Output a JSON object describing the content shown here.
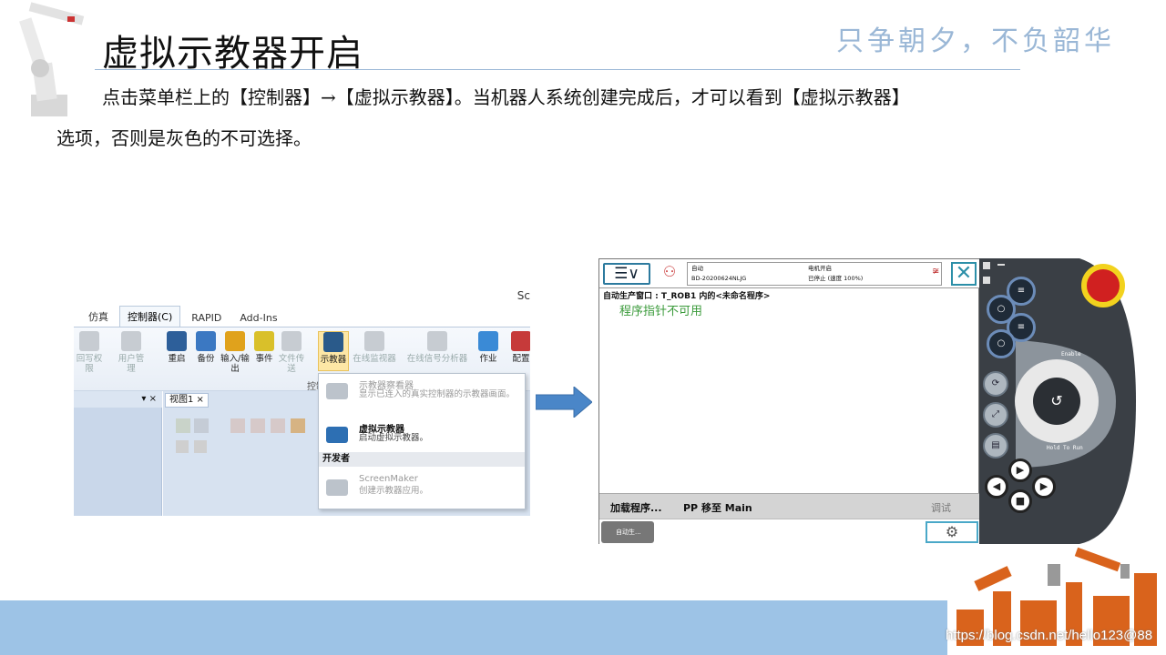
{
  "slide": {
    "title": "虚拟示教器开启",
    "motto": "只争朝夕，不负韶华",
    "body_line1": "点击菜单栏上的【控制器】→【虚拟示教器】。当机器人系统创建完成后，才可以看到【虚拟示教器】",
    "body_line2": "选项，否则是灰色的不可选择。",
    "watermark": "https://blog.csdn.net/hello123@88"
  },
  "ribbon": {
    "corner_text": "Sc",
    "tabs": [
      {
        "label": "仿真",
        "active": false
      },
      {
        "label": "控制器(C)",
        "active": true
      },
      {
        "label": "RAPID",
        "active": false
      },
      {
        "label": "Add-Ins",
        "active": false
      }
    ],
    "buttons": [
      {
        "label": "回写权限",
        "icon": "write-access-icon",
        "enabled": false,
        "color": "#c7ccd2"
      },
      {
        "label": "用户管理",
        "icon": "user-management-icon",
        "enabled": false,
        "color": "#c7ccd2"
      },
      {
        "label": "重启",
        "icon": "restart-icon",
        "enabled": true,
        "color": "#2d5f9a"
      },
      {
        "label": "备份",
        "icon": "backup-icon",
        "enabled": true,
        "color": "#3b78c2"
      },
      {
        "label": "输入/输出",
        "icon": "io-icon",
        "enabled": true,
        "color": "#e0a21c"
      },
      {
        "label": "事件",
        "icon": "event-icon",
        "enabled": true,
        "color": "#d9c02a"
      },
      {
        "label": "文件传送",
        "icon": "file-transfer-icon",
        "enabled": false,
        "color": "#c7ccd2"
      },
      {
        "label": "示教器",
        "icon": "flexpendant-icon",
        "enabled": true,
        "color": "#2a5a8a"
      },
      {
        "label": "在线监视器",
        "icon": "online-monitor-icon",
        "enabled": false,
        "color": "#c7ccd2"
      },
      {
        "label": "在线信号分析器",
        "icon": "signal-analyzer-icon",
        "enabled": false,
        "color": "#c7ccd2"
      },
      {
        "label": "作业",
        "icon": "job-icon",
        "enabled": true,
        "color": "#3a8ad6"
      },
      {
        "label": "配置",
        "icon": "config-icon",
        "enabled": true,
        "color": "#c63a3a"
      }
    ],
    "group_label": "控制",
    "pane_controls": "▾ ×",
    "view_tab": "视图1 ×",
    "dropdown": {
      "item1_title": "示教器察看器",
      "item1_desc": "显示已连入的真实控制器的示教器画面。",
      "item2_title": "虚拟示教器",
      "item2_desc": "启动虚拟示教器。",
      "section_header": "开发者",
      "item3_title": "ScreenMaker",
      "item3_desc": "创建示教器应用。"
    }
  },
  "pendant": {
    "status_mode": "自动",
    "status_controller": "BD-20200624NLJG",
    "status_motor": "电机开启",
    "status_state": "已停止 (速度 100%)",
    "window_title": "自动生产窗口 : T_ROB1 内的<未命名程序>",
    "message": "程序指针不可用",
    "load_program": "加载程序...",
    "pp_to_main": "PP 移至 Main",
    "debug": "调试",
    "task_button": "自动生...",
    "enable_label": "Enable",
    "hold_label": "Hold To Run",
    "colors": {
      "accent": "#2c8fa8",
      "message": "#3a9a3a",
      "estop": "#d02020"
    }
  }
}
